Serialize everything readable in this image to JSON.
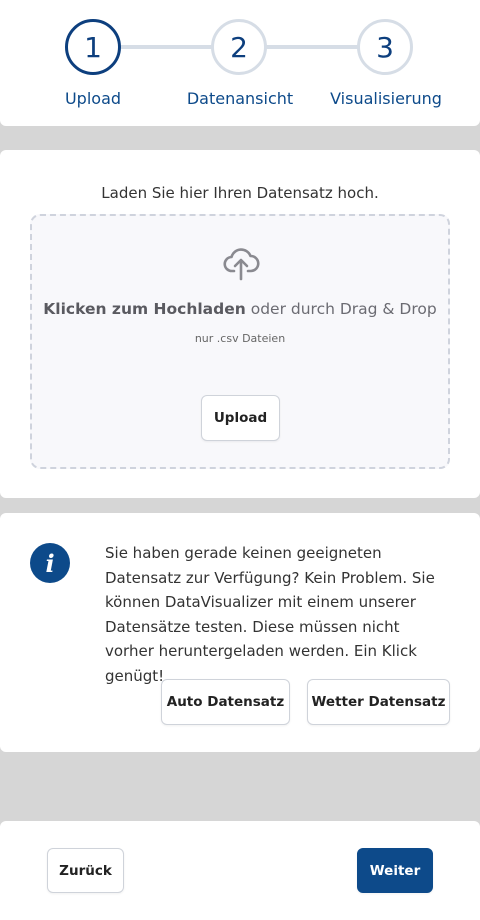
{
  "stepper": {
    "steps": [
      {
        "number": "1",
        "label": "Upload",
        "active": true
      },
      {
        "number": "2",
        "label": "Datenansicht",
        "active": false
      },
      {
        "number": "3",
        "label": "Visualisierung",
        "active": false
      }
    ]
  },
  "upload": {
    "intro": "Laden Sie hier Ihren Datensatz hoch.",
    "icon": "cloud-upload-icon",
    "drop_bold": "Klicken zum Hochladen",
    "drop_rest": " oder durch Drag & Drop",
    "hint": "nur .csv Dateien",
    "button_label": "Upload"
  },
  "info": {
    "icon": "info-icon",
    "icon_glyph": "i",
    "text": "Sie haben gerade keinen geeigneten Datensatz zur Verfügung? Kein Problem. Sie können DataVisualizer mit einem unserer Datensätze testen. Diese müssen nicht vorher heruntergeladen werden. Ein Klick genügt!",
    "auto_label": "Auto Datensatz",
    "wetter_label": "Wetter Datensatz"
  },
  "footer": {
    "back_label": "Zurück",
    "next_label": "Weiter"
  },
  "colors": {
    "primary": "#0d4a8a",
    "step_inactive": "#d6dde6",
    "background": "#d6d6d6"
  }
}
